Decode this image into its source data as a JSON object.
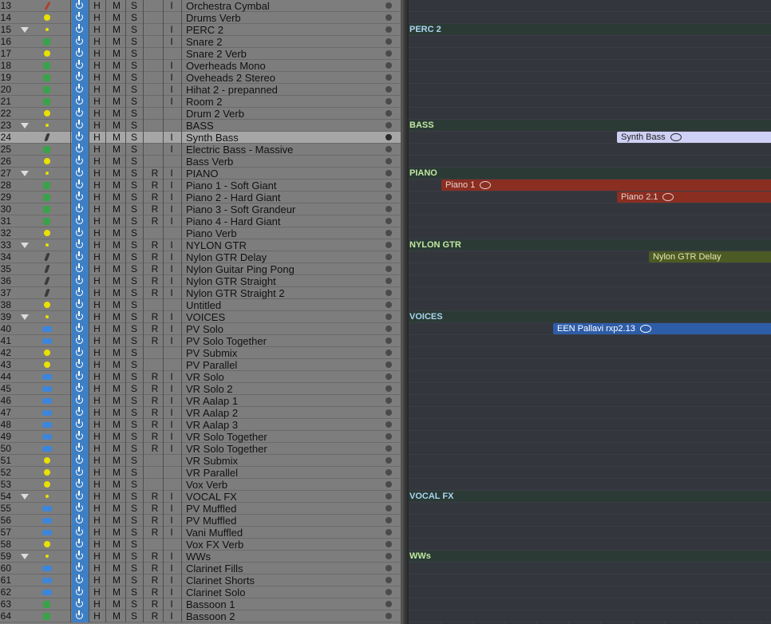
{
  "tracks": [
    {
      "num": "13",
      "type": "drum",
      "icon": "drum-icon",
      "name": "Orchestra Cymbal",
      "r": false,
      "i": true
    },
    {
      "num": "14",
      "type": "aux",
      "icon": "aux-icon",
      "name": "Drums Verb",
      "r": false,
      "i": false
    },
    {
      "num": "15",
      "type": "folder",
      "icon": "folder-icon",
      "name": "PERC 2",
      "r": false,
      "i": true,
      "fold": true
    },
    {
      "num": "16",
      "type": "soft",
      "icon": "instrument-icon",
      "name": "Snare 2",
      "r": false,
      "i": true
    },
    {
      "num": "17",
      "type": "aux",
      "icon": "aux-icon",
      "name": "Snare 2 Verb",
      "r": false,
      "i": false
    },
    {
      "num": "18",
      "type": "soft",
      "icon": "instrument-icon",
      "name": "Overheads Mono",
      "r": false,
      "i": true
    },
    {
      "num": "19",
      "type": "soft",
      "icon": "instrument-icon",
      "name": "Oveheads 2 Stereo",
      "r": false,
      "i": true
    },
    {
      "num": "20",
      "type": "soft",
      "icon": "instrument-icon",
      "name": "Hihat 2 - prepanned",
      "r": false,
      "i": true
    },
    {
      "num": "21",
      "type": "soft",
      "icon": "instrument-icon",
      "name": "Room 2",
      "r": false,
      "i": true
    },
    {
      "num": "22",
      "type": "aux",
      "icon": "aux-icon",
      "name": "Drum 2 Verb",
      "r": false,
      "i": false
    },
    {
      "num": "23",
      "type": "folder",
      "icon": "folder-icon",
      "name": "BASS",
      "r": false,
      "i": false,
      "fold": true
    },
    {
      "num": "24",
      "type": "midi",
      "icon": "midi-icon",
      "name": "Synth Bass",
      "r": false,
      "i": true,
      "selected": true
    },
    {
      "num": "25",
      "type": "soft",
      "icon": "instrument-icon",
      "name": "Electric Bass - Massive",
      "r": false,
      "i": true
    },
    {
      "num": "26",
      "type": "aux",
      "icon": "aux-icon",
      "name": "Bass Verb",
      "r": false,
      "i": false
    },
    {
      "num": "27",
      "type": "folder",
      "icon": "folder-icon",
      "name": "PIANO",
      "r": true,
      "i": true,
      "fold": true
    },
    {
      "num": "28",
      "type": "soft",
      "icon": "instrument-icon",
      "name": "Piano 1 - Soft Giant",
      "r": true,
      "i": true
    },
    {
      "num": "29",
      "type": "soft",
      "icon": "instrument-icon",
      "name": "Piano 2 - Hard Giant",
      "r": true,
      "i": true
    },
    {
      "num": "30",
      "type": "soft",
      "icon": "instrument-icon",
      "name": "Piano 3 - Soft Grandeur",
      "r": true,
      "i": true
    },
    {
      "num": "31",
      "type": "soft",
      "icon": "instrument-icon",
      "name": "Piano 4 - Hard Giant",
      "r": true,
      "i": true
    },
    {
      "num": "32",
      "type": "aux",
      "icon": "aux-icon",
      "name": "Piano Verb",
      "r": false,
      "i": false
    },
    {
      "num": "33",
      "type": "folder",
      "icon": "folder-icon",
      "name": "NYLON GTR",
      "r": true,
      "i": true,
      "fold": true
    },
    {
      "num": "34",
      "type": "midi",
      "icon": "midi-icon",
      "name": "Nylon GTR Delay",
      "r": true,
      "i": true
    },
    {
      "num": "35",
      "type": "midi",
      "icon": "midi-icon",
      "name": "Nylon Guitar Ping Pong",
      "r": true,
      "i": true
    },
    {
      "num": "36",
      "type": "midi",
      "icon": "midi-icon",
      "name": "Nylon GTR Straight",
      "r": true,
      "i": true
    },
    {
      "num": "37",
      "type": "midi",
      "icon": "midi-icon",
      "name": "Nylon GTR Straight 2",
      "r": true,
      "i": true
    },
    {
      "num": "38",
      "type": "aux",
      "icon": "aux-icon",
      "name": "Untitled",
      "r": false,
      "i": false
    },
    {
      "num": "39",
      "type": "folder",
      "icon": "folder-icon",
      "name": "VOICES",
      "r": true,
      "i": true,
      "fold": true
    },
    {
      "num": "40",
      "type": "audio",
      "icon": "audio-icon",
      "name": "PV Solo",
      "r": true,
      "i": true
    },
    {
      "num": "41",
      "type": "audio",
      "icon": "audio-icon",
      "name": "PV Solo Together",
      "r": true,
      "i": true
    },
    {
      "num": "42",
      "type": "aux",
      "icon": "aux-icon",
      "name": "PV Submix",
      "r": false,
      "i": false
    },
    {
      "num": "43",
      "type": "aux",
      "icon": "aux-icon",
      "name": "PV Parallel",
      "r": false,
      "i": false
    },
    {
      "num": "44",
      "type": "audio",
      "icon": "audio-icon",
      "name": "VR Solo",
      "r": true,
      "i": true
    },
    {
      "num": "45",
      "type": "audio",
      "icon": "audio-icon",
      "name": "VR Solo 2",
      "r": true,
      "i": true
    },
    {
      "num": "46",
      "type": "audio",
      "icon": "audio-icon",
      "name": "VR Aalap 1",
      "r": true,
      "i": true
    },
    {
      "num": "47",
      "type": "audio",
      "icon": "audio-icon",
      "name": "VR Aalap 2",
      "r": true,
      "i": true
    },
    {
      "num": "48",
      "type": "audio",
      "icon": "audio-icon",
      "name": "VR Aalap 3",
      "r": true,
      "i": true
    },
    {
      "num": "49",
      "type": "audio",
      "icon": "audio-icon",
      "name": "VR Solo Together",
      "r": true,
      "i": true
    },
    {
      "num": "50",
      "type": "audio",
      "icon": "audio-icon",
      "name": "VR Solo Together",
      "r": true,
      "i": true
    },
    {
      "num": "51",
      "type": "aux",
      "icon": "aux-icon",
      "name": "VR Submix",
      "r": false,
      "i": false
    },
    {
      "num": "52",
      "type": "aux",
      "icon": "aux-icon",
      "name": "VR Parallel",
      "r": false,
      "i": false
    },
    {
      "num": "53",
      "type": "aux",
      "icon": "aux-icon",
      "name": "Vox Verb",
      "r": false,
      "i": false
    },
    {
      "num": "54",
      "type": "folder",
      "icon": "folder-icon",
      "name": "VOCAL FX",
      "r": true,
      "i": true,
      "fold": true
    },
    {
      "num": "55",
      "type": "audio",
      "icon": "audio-icon",
      "name": "PV Muffled",
      "r": true,
      "i": true
    },
    {
      "num": "56",
      "type": "audio",
      "icon": "audio-icon",
      "name": "PV Muffled",
      "r": true,
      "i": true
    },
    {
      "num": "57",
      "type": "audio",
      "icon": "audio-icon",
      "name": "Vani Muffled",
      "r": true,
      "i": true
    },
    {
      "num": "58",
      "type": "aux",
      "icon": "aux-icon",
      "name": "Vox FX Verb",
      "r": false,
      "i": false
    },
    {
      "num": "59",
      "type": "folder",
      "icon": "folder-icon",
      "name": "WWs",
      "r": true,
      "i": true,
      "fold": true
    },
    {
      "num": "60",
      "type": "audio",
      "icon": "audio-icon",
      "name": "Clarinet Fills",
      "r": true,
      "i": true
    },
    {
      "num": "61",
      "type": "audio",
      "icon": "audio-icon",
      "name": "Clarinet Shorts",
      "r": true,
      "i": true
    },
    {
      "num": "62",
      "type": "audio",
      "icon": "audio-icon",
      "name": "Clarinet Solo",
      "r": true,
      "i": true
    },
    {
      "num": "63",
      "type": "soft",
      "icon": "instrument-icon",
      "name": "Bassoon 1",
      "r": true,
      "i": true
    },
    {
      "num": "64",
      "type": "soft",
      "icon": "instrument-icon",
      "name": "Bassoon 2",
      "r": true,
      "i": true
    }
  ],
  "buttons": {
    "hide": "H",
    "mute": "M",
    "solo": "S",
    "record": "R",
    "input": "I"
  },
  "folder_labels": [
    {
      "track": "15",
      "label": "PERC 2",
      "color": "#a7d6ef"
    },
    {
      "track": "23",
      "label": "BASS",
      "color": "#bfe89f"
    },
    {
      "track": "27",
      "label": "PIANO",
      "color": "#bfe89f"
    },
    {
      "track": "33",
      "label": "NYLON GTR",
      "color": "#bfe89f"
    },
    {
      "track": "39",
      "label": "VOICES",
      "color": "#a7d6ef"
    },
    {
      "track": "54",
      "label": "VOCAL FX",
      "color": "#a7d6ef"
    },
    {
      "track": "59",
      "label": "WWs",
      "color": "#bfe89f"
    }
  ],
  "regions": [
    {
      "track": "24",
      "label": "Synth Bass",
      "bar": 13,
      "bg": "#cfd0f5",
      "fg": "#222",
      "loop": true
    },
    {
      "track": "28",
      "label": "Piano 1",
      "bar": 2,
      "bg": "#8b2e22",
      "fg": "#e7d2cc",
      "loop": true
    },
    {
      "track": "29",
      "label": "Piano 2.1",
      "bar": 13,
      "bg": "#8b2e22",
      "fg": "#e7d2cc",
      "loop": true
    },
    {
      "track": "34",
      "label": "Nylon GTR Delay",
      "bar": 15,
      "bg": "#4c5a24",
      "fg": "#e8e8b0",
      "loop": false
    },
    {
      "track": "40",
      "label": "EEN Pallavi rxp2.13",
      "bar": 9,
      "bg": "#2e5da8",
      "fg": "#ffffff",
      "loop": true
    }
  ],
  "colors": {
    "accent": "#3e7fc4",
    "selected_row": "#a6a6a6"
  }
}
